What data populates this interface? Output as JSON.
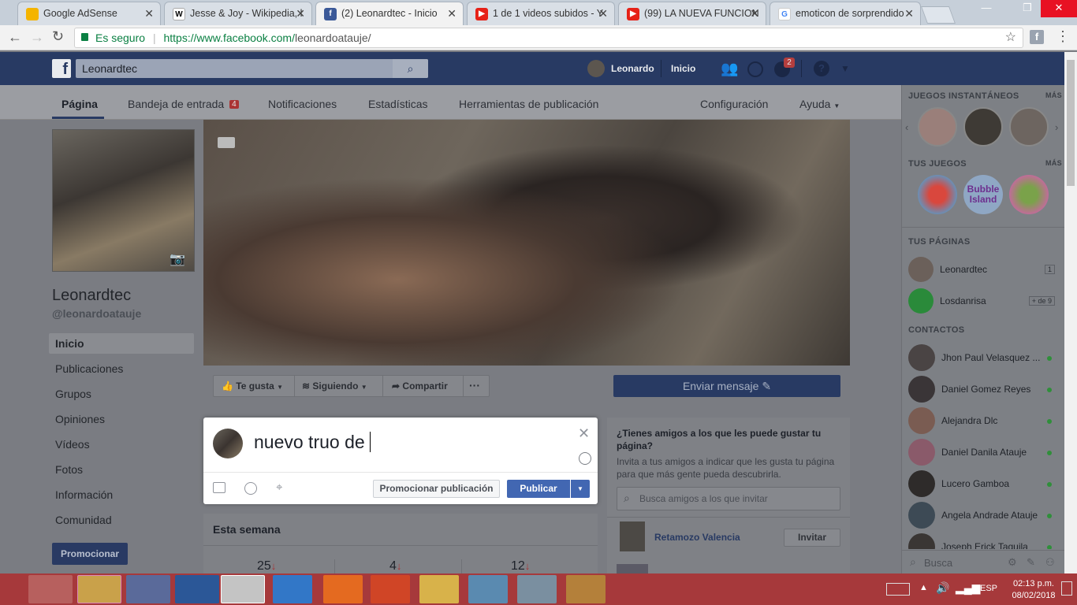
{
  "browser": {
    "tabs": [
      {
        "title": "Google AdSense",
        "icon": "adsense-icon",
        "color": "#f4b400"
      },
      {
        "title": "Jesse & Joy - Wikipedia, l",
        "icon": "wikipedia-icon",
        "color": "#ffffff"
      },
      {
        "title": "(2) Leonardtec - Inicio",
        "icon": "facebook-icon",
        "color": "#3b5998"
      },
      {
        "title": "1 de 1 videos subidos - Y",
        "icon": "youtube-icon",
        "color": "#e62117"
      },
      {
        "title": "(99) LA NUEVA FUNCION",
        "icon": "youtube-icon",
        "color": "#e62117"
      },
      {
        "title": "emoticon de sorprendido",
        "icon": "google-icon",
        "color": "#4285f4"
      }
    ],
    "secure_label": "Es seguro",
    "url_prefix": "https://www.facebook.com/",
    "url_path": "leonardoatauje/"
  },
  "fb_header": {
    "search_value": "Leonardtec",
    "user_name": "Leonardo",
    "home_label": "Inicio",
    "notification_count": "2"
  },
  "page_tabs": {
    "pagina": "Página",
    "bandeja": "Bandeja de entrada",
    "bandeja_badge": "4",
    "notificaciones": "Notificaciones",
    "estadisticas": "Estadísticas",
    "herramientas": "Herramientas de publicación",
    "configuracion": "Configuración",
    "ayuda": "Ayuda"
  },
  "profile": {
    "name": "Leonardtec",
    "handle": "@leonardoatauje"
  },
  "left_nav": [
    "Inicio",
    "Publicaciones",
    "Grupos",
    "Opiniones",
    "Vídeos",
    "Fotos",
    "Información",
    "Comunidad"
  ],
  "promote_button": "Promocionar",
  "actions": {
    "like": "Te gusta",
    "following": "Siguiendo",
    "share": "Compartir",
    "more": "···",
    "send_message": "Enviar mensaje"
  },
  "composer": {
    "text": "nuevo truo de",
    "promote_post": "Promocionar publicación",
    "publish": "Publicar"
  },
  "this_week": {
    "title": "Esta semana",
    "stats": [
      "25",
      "4",
      "12"
    ]
  },
  "invite": {
    "title": "¿Tienes amigos a los que les puede gustar tu página?",
    "desc": "Invita a tus amigos a indicar que les gusta tu página para que más gente pueda descubrirla.",
    "search_placeholder": "Busca amigos a los que invitar",
    "friend": "Retamozo Valencia",
    "invite_btn": "Invitar"
  },
  "sidebar": {
    "instant_games": "JUEGOS INSTANTÁNEOS",
    "more1": "MÁS",
    "your_games": "TUS JUEGOS",
    "more2": "MÁS",
    "game_bubble": "Bubble Island",
    "your_pages": "TUS PÁGINAS",
    "pages": [
      {
        "name": "Leonardtec",
        "badge": "1"
      },
      {
        "name": "Losdanrisa",
        "badge": "+ de 9"
      }
    ],
    "contacts_title": "CONTACTOS",
    "contacts": [
      "Jhon Paul Velasquez ...",
      "Daniel Gomez Reyes",
      "Alejandra Dlc",
      "Daniel Danila Atauje",
      "Lucero Gamboa",
      "Angela Andrade Atauje",
      "Joseph Erick Taquila"
    ],
    "search_placeholder": "Busca"
  },
  "taskbar": {
    "lang": "ESP",
    "time": "02:13 p.m.",
    "date": "08/02/2018"
  }
}
